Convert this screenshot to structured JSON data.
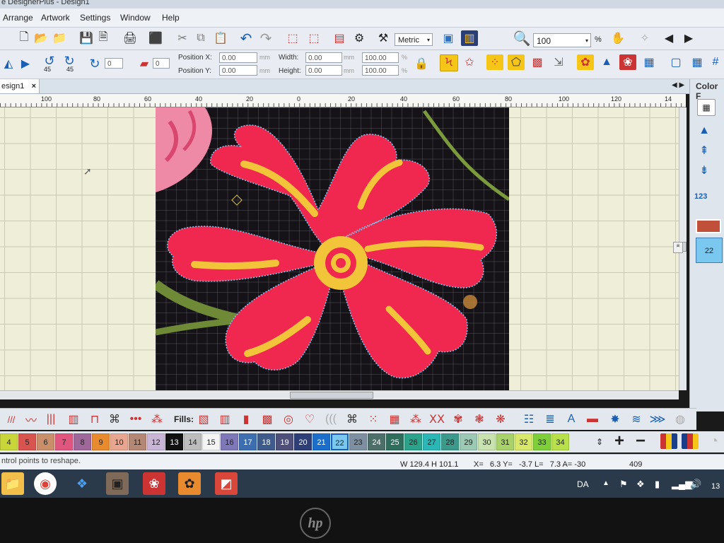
{
  "window": {
    "title": "e DesignerPlus - Design1"
  },
  "menu": [
    "Arrange",
    "Artwork",
    "Settings",
    "Window",
    "Help"
  ],
  "toolbar1": {
    "units_select": "Metric",
    "zoom_value": "100",
    "zoom_unit": "%"
  },
  "toolbar2": {
    "angle1": "0",
    "angle2": "0",
    "position_x_label": "Position X:",
    "position_x": "0.00",
    "position_y_label": "Position Y:",
    "position_y": "0.00",
    "width_label": "Width:",
    "width": "0.00",
    "height_label": "Height:",
    "height": "0.00",
    "width_pct": "100.00",
    "height_pct": "100.00",
    "unit_mm": "mm",
    "unit_pct": "%",
    "icon_badge_1": "45",
    "icon_badge_2": "45"
  },
  "document_tab": {
    "label": "esign1",
    "close": "×"
  },
  "right_panel": {
    "title": "Color F",
    "chip": "22",
    "counter": "123"
  },
  "ruler_ticks": [
    "100",
    "80",
    "60",
    "40",
    "20",
    "0",
    "20",
    "40",
    "60",
    "80",
    "100",
    "120",
    "14"
  ],
  "fills": {
    "label": "Fills:"
  },
  "palette": [
    {
      "num": "4",
      "color": "#c9d63a"
    },
    {
      "num": "5",
      "color": "#d9534f"
    },
    {
      "num": "6",
      "color": "#c98f6a"
    },
    {
      "num": "7",
      "color": "#e0567e"
    },
    {
      "num": "8",
      "color": "#a0679a"
    },
    {
      "num": "9",
      "color": "#e88a2e"
    },
    {
      "num": "10",
      "color": "#e8a58f"
    },
    {
      "num": "11",
      "color": "#b58876"
    },
    {
      "num": "12",
      "color": "#c9b6d6"
    },
    {
      "num": "13",
      "color": "#111111"
    },
    {
      "num": "14",
      "color": "#bdbdbd"
    },
    {
      "num": "15",
      "color": "#f4f4f4"
    },
    {
      "num": "16",
      "color": "#7f78b8"
    },
    {
      "num": "17",
      "color": "#3d6fb0"
    },
    {
      "num": "18",
      "color": "#3f5b8c"
    },
    {
      "num": "19",
      "color": "#4e4f7a"
    },
    {
      "num": "20",
      "color": "#2e3f78"
    },
    {
      "num": "21",
      "color": "#1b6ec9"
    },
    {
      "num": "22",
      "color": "#7ac7f0"
    },
    {
      "num": "23",
      "color": "#7d8fa0"
    },
    {
      "num": "24",
      "color": "#4d6f6a"
    },
    {
      "num": "25",
      "color": "#2f6e5d"
    },
    {
      "num": "26",
      "color": "#2aa38a"
    },
    {
      "num": "27",
      "color": "#2ab7b5"
    },
    {
      "num": "28",
      "color": "#3c9a8c"
    },
    {
      "num": "29",
      "color": "#9bc9b4"
    },
    {
      "num": "30",
      "color": "#c8e2b0"
    },
    {
      "num": "31",
      "color": "#a9d36a"
    },
    {
      "num": "32",
      "color": "#d8e86a"
    },
    {
      "num": "33",
      "color": "#7fcf3a"
    },
    {
      "num": "34",
      "color": "#b8e04a"
    }
  ],
  "status": {
    "hint": "ntrol points to reshape.",
    "dims": "W 129.4 H 101.1",
    "coords": "X=   6.3 Y=   -3.7 L=   7.3 A= -30",
    "count": "409"
  },
  "taskbar": {
    "lang": "DA",
    "time": "13"
  },
  "colors": {
    "flower_red": "#f0284f",
    "flower_yellow": "#f2c43a",
    "leaf_green": "#7a9a3c",
    "highlight": "#7ac7f0"
  }
}
